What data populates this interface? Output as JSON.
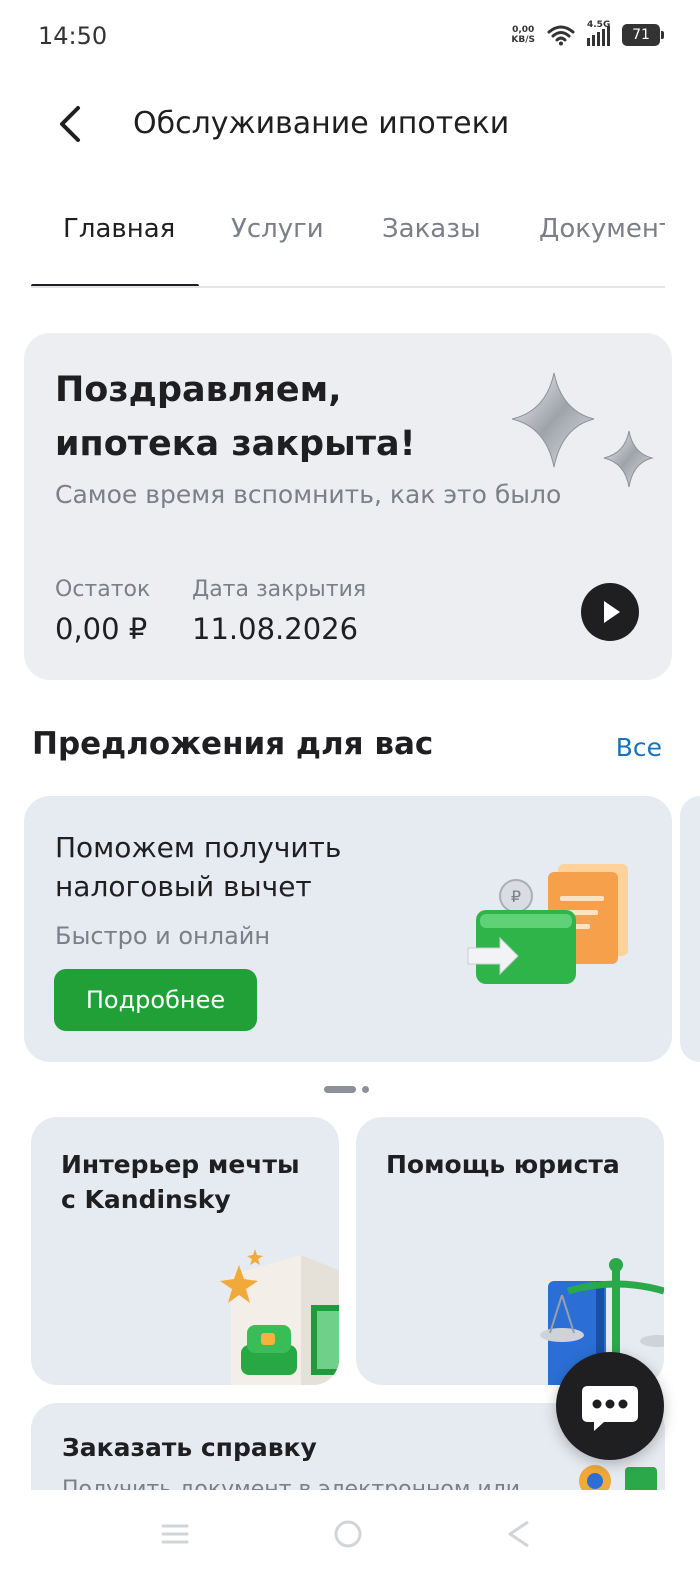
{
  "status_bar": {
    "time": "14:50",
    "net_speed_value": "0,00",
    "net_speed_unit": "KB/S",
    "network_type": "4.5G",
    "battery": "71"
  },
  "header": {
    "title": "Обслуживание ипотеки"
  },
  "tabs": [
    {
      "label": "Главная"
    },
    {
      "label": "Услуги"
    },
    {
      "label": "Заказы"
    },
    {
      "label": "Документы"
    }
  ],
  "hero": {
    "title": "Поздравляем, ипотека закрыта!",
    "subtitle": "Самое время вспомнить, как это было",
    "balance_label": "Остаток",
    "balance_value": "0,00 ₽",
    "close_date_label": "Дата закрытия",
    "close_date_value": "11.08.2026"
  },
  "offers": {
    "section_title": "Предложения для вас",
    "all_link": "Все",
    "card": {
      "title": "Поможем получить налоговый вычет",
      "subtitle": "Быстро и онлайн",
      "button": "Подробнее"
    },
    "carousel_pages": 2,
    "carousel_active": 1
  },
  "tiles": [
    {
      "title": "Интерьер мечты с Kandinsky"
    },
    {
      "title": "Помощь юриста"
    }
  ],
  "wide_card": {
    "title": "Заказать справку",
    "subtitle": "Получить документ в электронном или"
  },
  "colors": {
    "accent_green": "#21a038",
    "link_blue": "#1a73b8",
    "card_bg": "#e6ebf1",
    "dark": "#1f1f22"
  }
}
